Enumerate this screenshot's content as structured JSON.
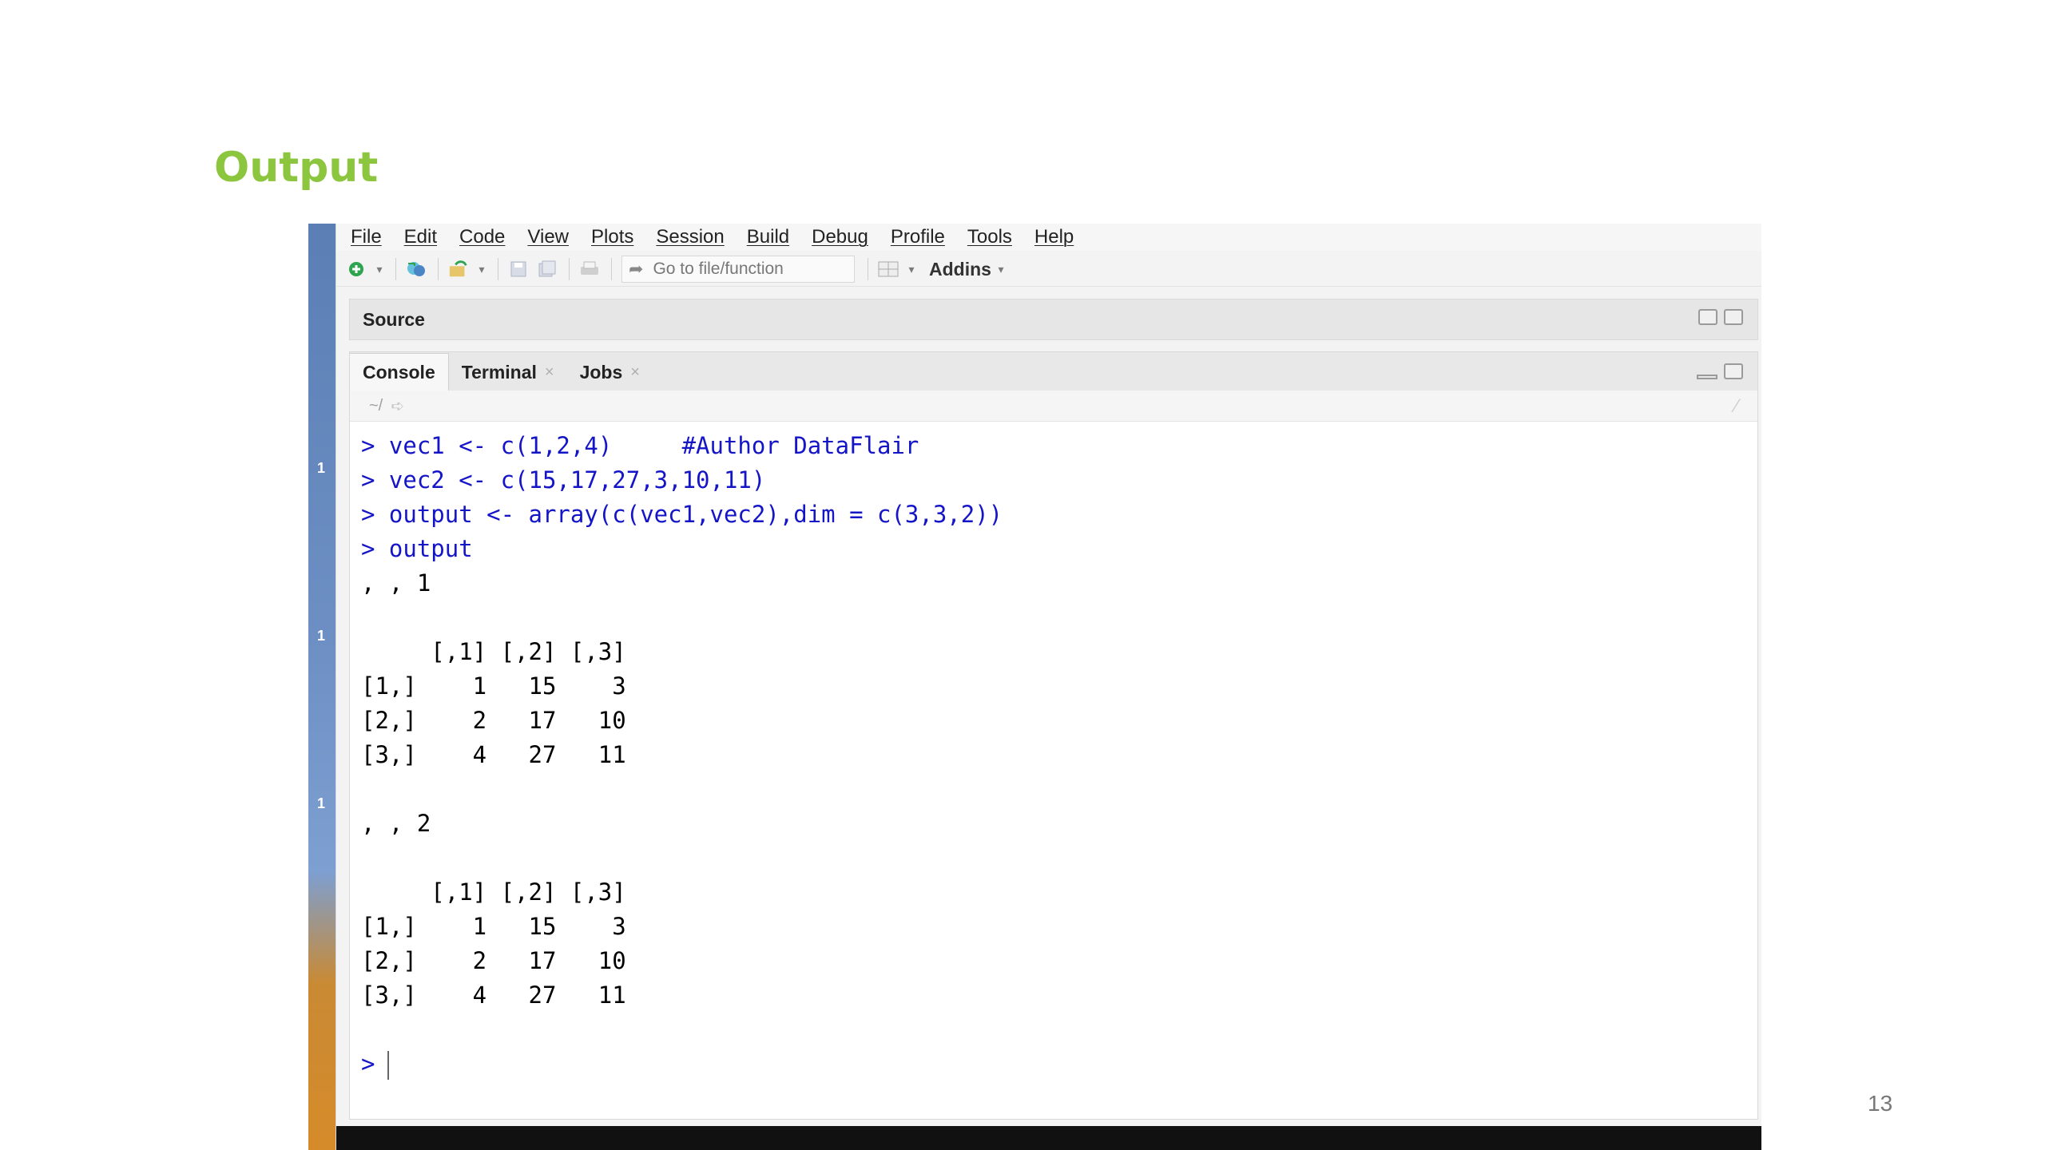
{
  "slide": {
    "title": "Output",
    "page_number": "13"
  },
  "menu": [
    "File",
    "Edit",
    "Code",
    "View",
    "Plots",
    "Session",
    "Build",
    "Debug",
    "Profile",
    "Tools",
    "Help"
  ],
  "toolbar": {
    "goto_placeholder": "Go to file/function",
    "addins_label": "Addins",
    "icons": [
      "new-file-icon",
      "open-project-icon",
      "open-file-icon",
      "save-icon",
      "save-all-icon",
      "print-icon",
      "grid-icon"
    ]
  },
  "source_pane": {
    "title": "Source"
  },
  "console_pane": {
    "tabs": [
      {
        "label": "Console"
      },
      {
        "label": "Terminal"
      },
      {
        "label": "Jobs"
      }
    ],
    "path": "~/",
    "lines": [
      {
        "prompt": "> ",
        "text": "vec1 <- c(1,2,4)     #Author DataFlair",
        "type": "cmd"
      },
      {
        "prompt": "> ",
        "text": "vec2 <- c(15,17,27,3,10,11)",
        "type": "cmd"
      },
      {
        "prompt": "> ",
        "text": "output <- array(c(vec1,vec2),dim = c(3,3,2))",
        "type": "cmd"
      },
      {
        "prompt": "> ",
        "text": "output",
        "type": "cmd"
      },
      {
        "prompt": "",
        "text": ", , 1",
        "type": "out"
      },
      {
        "prompt": "",
        "text": "",
        "type": "out"
      },
      {
        "prompt": "",
        "text": "     [,1] [,2] [,3]",
        "type": "out"
      },
      {
        "prompt": "",
        "text": "[1,]    1   15    3",
        "type": "out"
      },
      {
        "prompt": "",
        "text": "[2,]    2   17   10",
        "type": "out"
      },
      {
        "prompt": "",
        "text": "[3,]    4   27   11",
        "type": "out"
      },
      {
        "prompt": "",
        "text": "",
        "type": "out"
      },
      {
        "prompt": "",
        "text": ", , 2",
        "type": "out"
      },
      {
        "prompt": "",
        "text": "",
        "type": "out"
      },
      {
        "prompt": "",
        "text": "     [,1] [,2] [,3]",
        "type": "out"
      },
      {
        "prompt": "",
        "text": "[1,]    1   15    3",
        "type": "out"
      },
      {
        "prompt": "",
        "text": "[2,]    2   17   10",
        "type": "out"
      },
      {
        "prompt": "",
        "text": "[3,]    4   27   11",
        "type": "out"
      },
      {
        "prompt": "",
        "text": "",
        "type": "out"
      }
    ],
    "input_prompt": ">"
  },
  "colors": {
    "title": "#8cc63f",
    "command": "#1515c8",
    "output": "#000000"
  }
}
